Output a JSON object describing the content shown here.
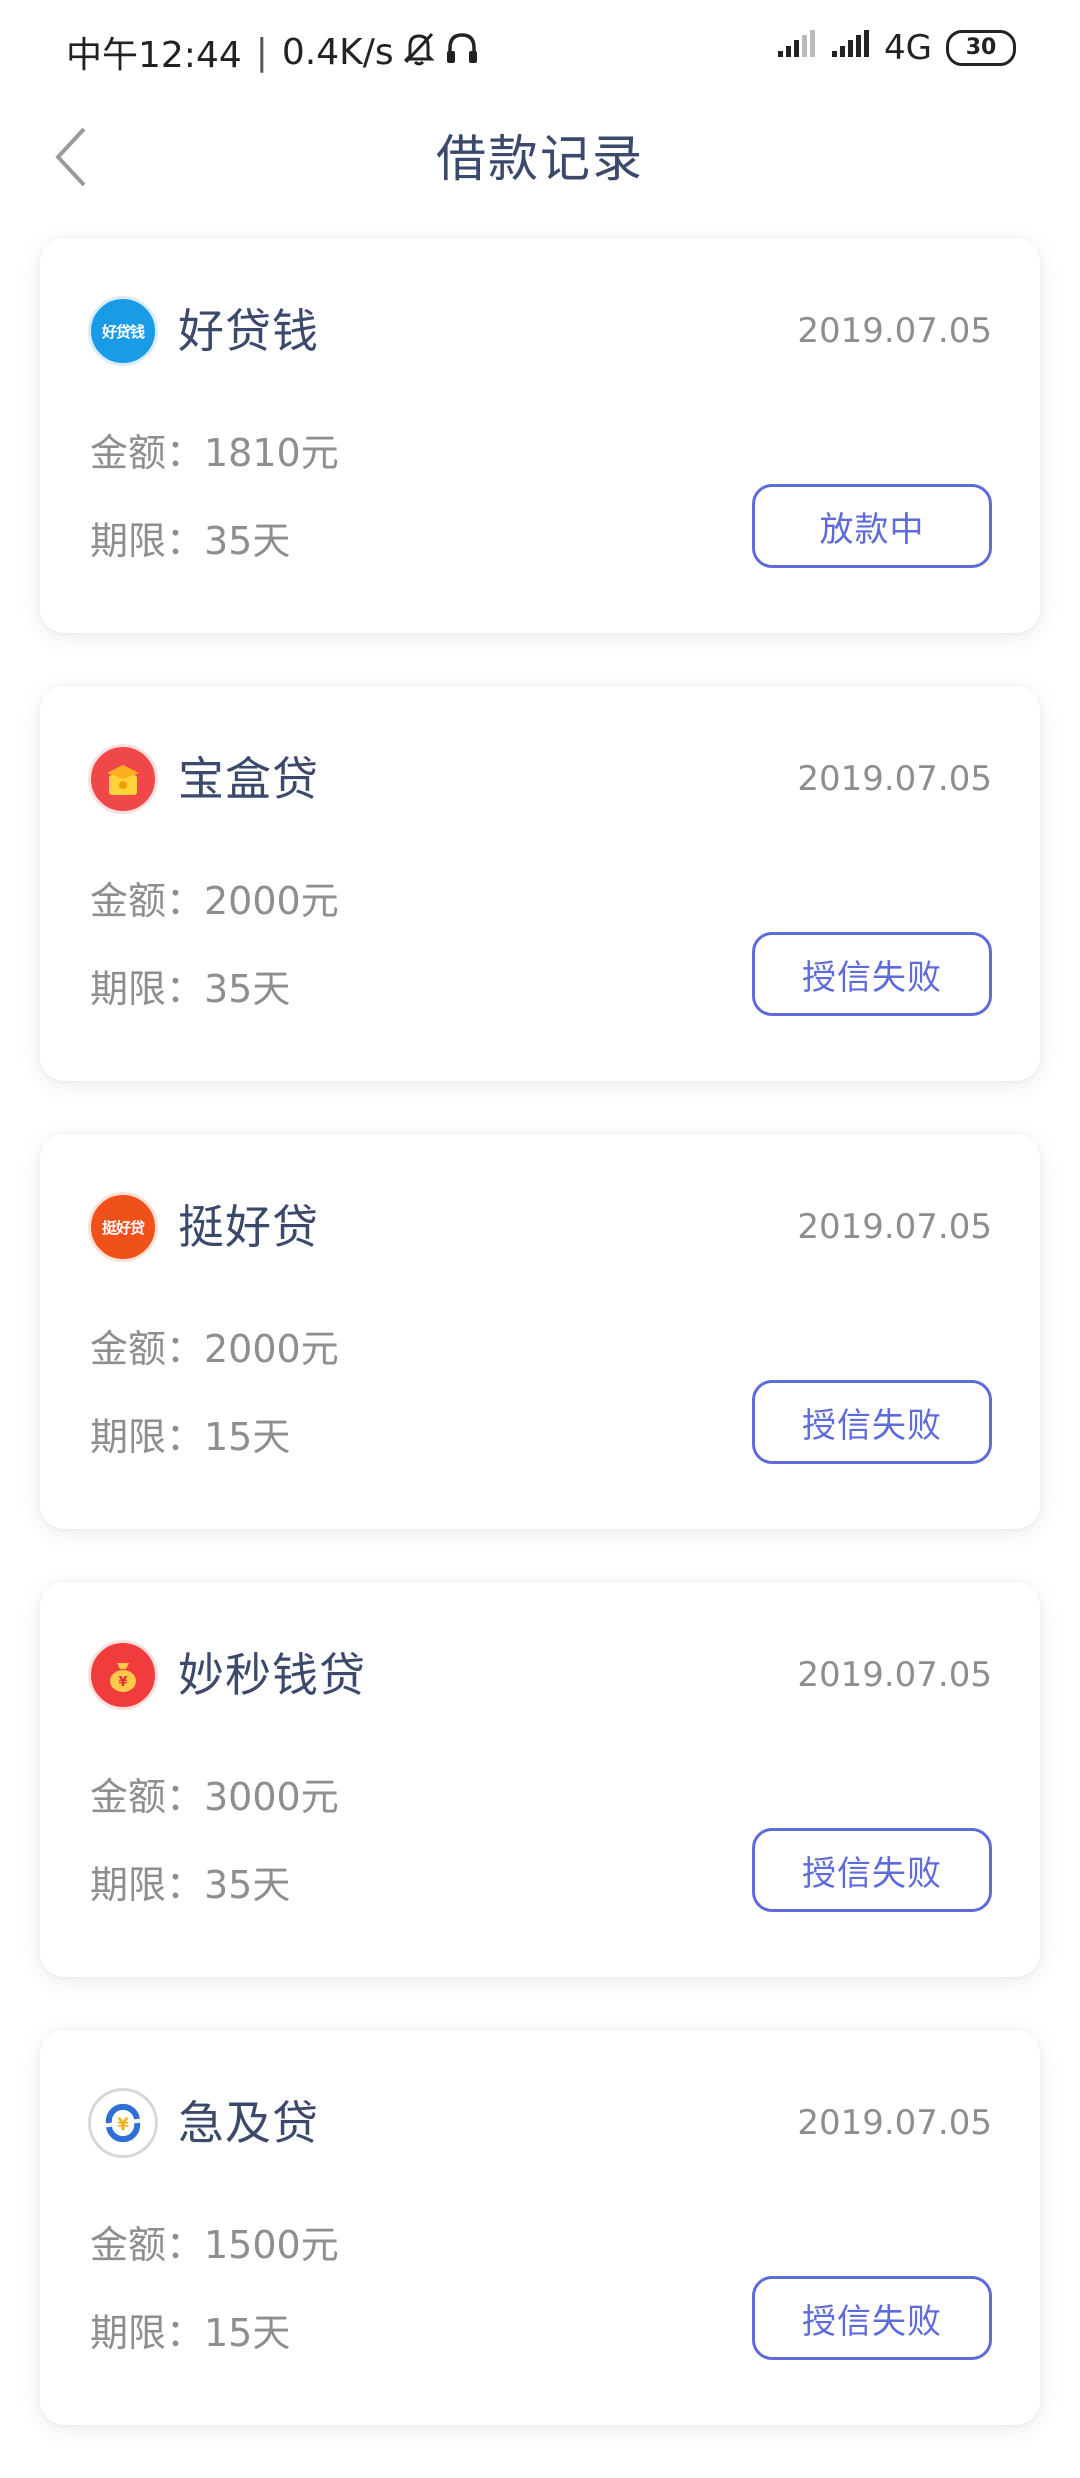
{
  "status_bar": {
    "time": "中午12:44",
    "speed": "0.4K/s",
    "network": "4G",
    "battery": "30",
    "icons": [
      "mute-bell-icon",
      "headphones-icon",
      "signal-icon",
      "signal-icon"
    ]
  },
  "header": {
    "title": "借款记录",
    "back_icon": "chevron-left-icon"
  },
  "colors": {
    "accent": "#5f6bd8",
    "title": "#3b4a6b",
    "muted": "#8e8e8e"
  },
  "loans": [
    {
      "name": "好贷钱",
      "logo_text": "好贷钱",
      "logo_color": "#1a9be6",
      "date": "2019.07.05",
      "amount": "金额：1810元",
      "term": "期限：35天",
      "status": "放款中"
    },
    {
      "name": "宝盒贷",
      "logo_text": "",
      "logo_color": "#f04848",
      "date": "2019.07.05",
      "amount": "金额：2000元",
      "term": "期限：35天",
      "status": "授信失败"
    },
    {
      "name": "挺好贷",
      "logo_text": "挺好贷",
      "logo_color": "#f0501a",
      "date": "2019.07.05",
      "amount": "金额：2000元",
      "term": "期限：15天",
      "status": "授信失败"
    },
    {
      "name": "妙秒钱贷",
      "logo_text": "",
      "logo_color": "#f03c3c",
      "date": "2019.07.05",
      "amount": "金额：3000元",
      "term": "期限：35天",
      "status": "授信失败"
    },
    {
      "name": "急及贷",
      "logo_text": "",
      "logo_color": "#2f6fd6",
      "date": "2019.07.05",
      "amount": "金额：1500元",
      "term": "期限：15天",
      "status": "授信失败"
    }
  ]
}
